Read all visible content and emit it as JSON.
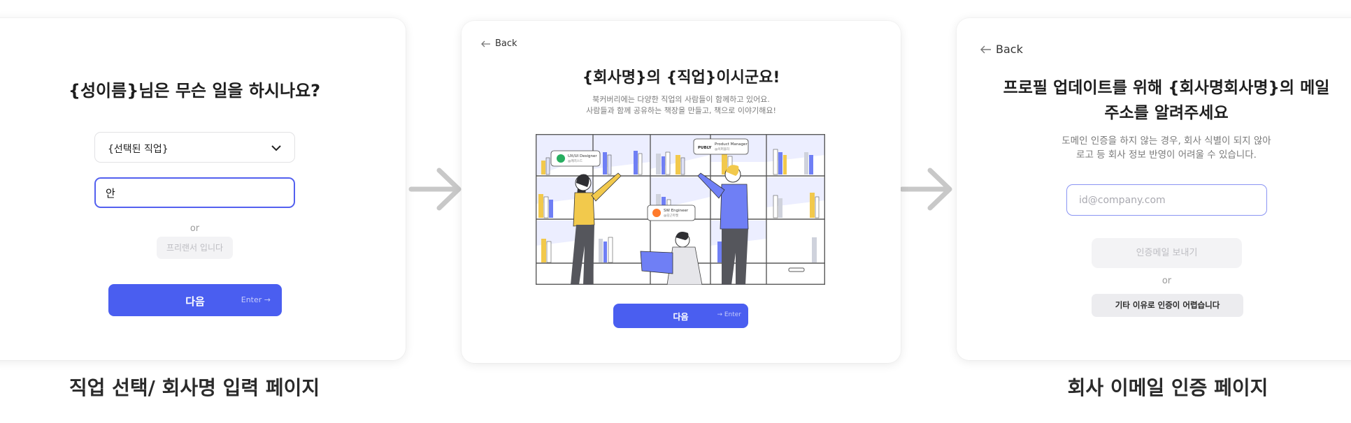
{
  "job_page": {
    "title": "{성이름}님은 무슨 일을 하시나요?",
    "selected_job": "{선택된 직업}",
    "company_input_value": "안",
    "or_label": "or",
    "freelancer_label": "프리랜서 입니다",
    "next_label": "다음",
    "next_hint": "Enter →",
    "caption": "직업 선택/ 회사명 입력 페이지"
  },
  "confirm_page": {
    "back_label": "Back",
    "title": "{회사명}의 {직업}이시군요!",
    "desc_line1": "북커버리에는 다양한 직업의 사람들이 함께하고 있어요.",
    "desc_line2": "사람들과 함께 공유하는 책장을 만들고, 책으로 이야기해요!",
    "illustration": {
      "bubble1_title": "UX/UI Designer",
      "bubble1_sub": "@캐치스드",
      "bubble2_logo": "PUBLY",
      "bubble2_title": "Product Manager",
      "bubble2_sub": "@이퍼블리",
      "bubble3_title": "SW Engineer",
      "bubble3_sub": "@당근마켓"
    },
    "next_label": "다음",
    "next_hint": "→ Enter"
  },
  "email_page": {
    "back_label": "Back",
    "title_line1": "프로필 업데이트를 위해 {회사명회사명}의 메일",
    "title_line2": "주소를 알려주세요",
    "desc_line1": "도메인 인증을 하지 않는 경우, 회사 식별이 되지 않아",
    "desc_line2": "로고 등 회사 정보 반영이 어려울 수 있습니다.",
    "email_placeholder": "id@company.com",
    "send_label": "인증메일 보내기",
    "or_label": "or",
    "other_reason_label": "기타 이유로 인증이 어렵습니다",
    "caption": "회사 이메일 인증 페이지"
  },
  "colors": {
    "primary": "#4a5ef0",
    "accent_yellow": "#f2c94c",
    "accent_blue": "#6f7ff5",
    "shelf_tint": "#e8eaff"
  },
  "icons": [
    "chevron-down-icon",
    "back-arrow-icon",
    "flow-arrow-icon"
  ]
}
